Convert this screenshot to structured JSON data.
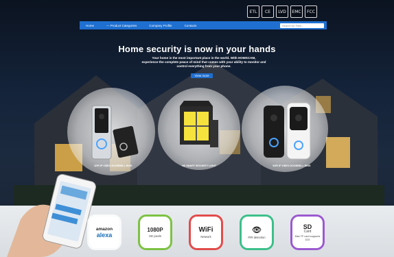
{
  "header": {
    "cert_marks": [
      "ETL",
      "CE",
      "LVD",
      "EMC",
      "FCC"
    ],
    "nav": {
      "items": [
        "Home",
        "— Product Categories",
        "Company Profile",
        "Contacts"
      ],
      "search_placeholder": "Search for Files..."
    }
  },
  "hero": {
    "headline": "Home security is now in your hands",
    "subtext_line1": "Your home is the most important place in the world. With HOMSCAM,",
    "subtext_line2": "experience the complete peace of mind that comes with your ability to monitor and",
    "subtext_line3": "control everything from your phone.",
    "cta": "View more"
  },
  "products": [
    {
      "label": "WIFI IP VIDEO DOORBELL RING"
    },
    {
      "label": "HD SMART SECURITY LIGHT"
    },
    {
      "label": "WIFI IP VIDEO DOORBELL RING"
    }
  ],
  "features": [
    {
      "big": "amazon",
      "big2": "alexa",
      "small": "",
      "color": "#4aa3e0"
    },
    {
      "big": "1080P",
      "big2": "",
      "small": "HD pixels",
      "color": "#7cc242"
    },
    {
      "big": "WiFi",
      "big2": "",
      "small": "Network",
      "color": "#e24b4b"
    },
    {
      "big": "👁",
      "big2": "",
      "small": "PIR detection",
      "color": "#3dbf8a"
    },
    {
      "big": "SD",
      "big2": "Card",
      "small": "Max TF card supports 32G",
      "color": "#9b59d0"
    }
  ]
}
